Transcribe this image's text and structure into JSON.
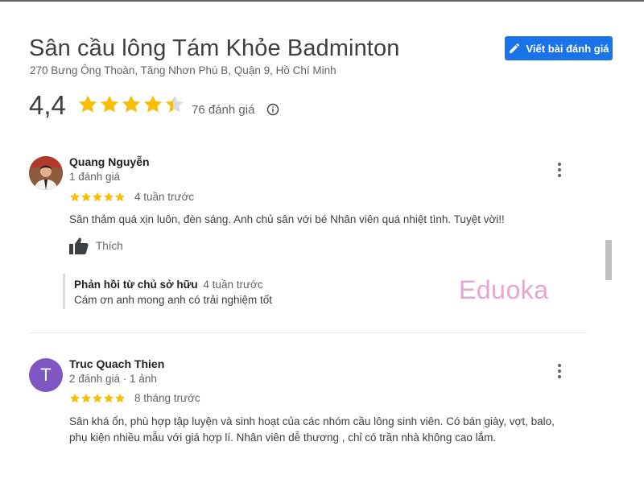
{
  "place": {
    "title": "Sân cầu lông Tám Khỏe Badminton",
    "address": "270 Bưng Ông Thoàn, Tăng Nhơn Phú B, Quận 9, Hồ Chí Minh",
    "rating": "4,4",
    "rating_value": 4.4,
    "review_count": "76 đánh giá"
  },
  "actions": {
    "write_review_label": "Viết bài đánh giá"
  },
  "reviews": [
    {
      "author": "Quang Nguyễn",
      "meta": "1 đánh giá",
      "stars": 5,
      "when": "4 tuần trước",
      "text": "Sân thảm quá xịn luôn, đèn sáng. Anh chủ sân với bé Nhân viên quá nhiệt tình. Tuyệt vời!!",
      "like_label": "Thích",
      "reply": {
        "owner_label": "Phản hồi từ chủ sở hữu",
        "when": "4 tuần trước",
        "text": "Cám ơn anh mong anh có trải nghiệm tốt"
      }
    },
    {
      "author": "Truc Quach Thien",
      "avatar_letter": "T",
      "meta": "2 đánh giá · 1 ảnh",
      "stars": 5,
      "when": "8 tháng trước",
      "text_line1": "Sân khá ổn, phù hợp tập luyện và sinh hoạt của các nhóm cầu lông sinh viên. Có bán giày, vợt, balo,",
      "text_line2": "phụ kiện nhiều mẫu với giá hợp lí. Nhân viên dễ thương , chỉ có trần nhà không cao lắm."
    }
  ],
  "watermark": "Eduoka",
  "colors": {
    "accent": "#1a73e8",
    "star": "#fbbc04",
    "star_empty": "#dadce0",
    "avatar_t": "#7e57c2",
    "watermark": "#e7a6d1"
  },
  "icons": [
    "edit-icon",
    "star-icon",
    "info-icon",
    "more-vert-icon",
    "thumb-up-icon"
  ]
}
